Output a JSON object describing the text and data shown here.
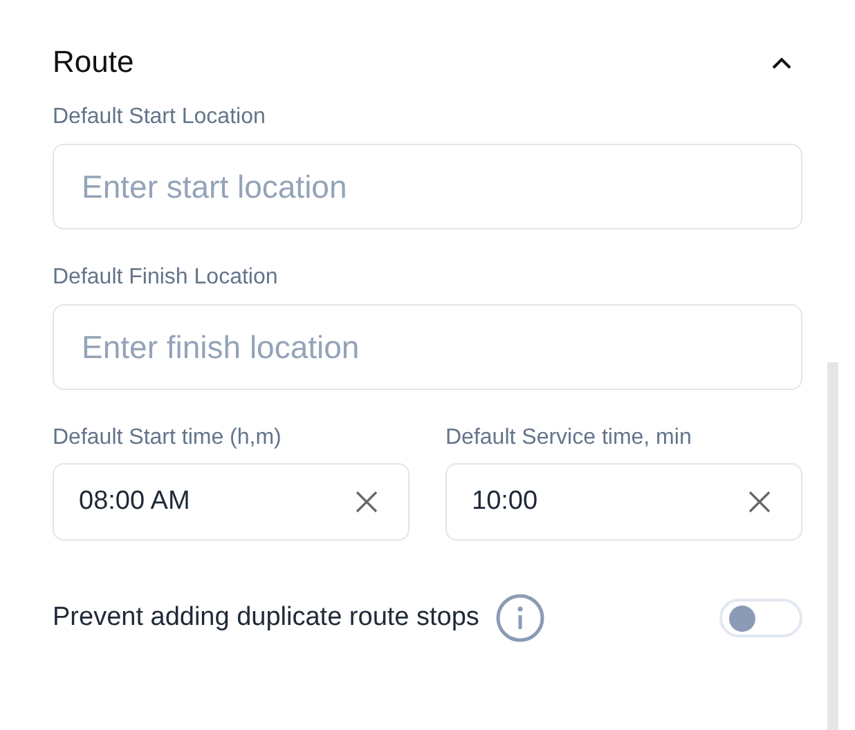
{
  "section": {
    "title": "Route",
    "expanded": true
  },
  "fields": [
    {
      "kind": "wide",
      "label": "Default Start Location",
      "placeholder": "Enter start location"
    },
    {
      "kind": "wide",
      "label": "Default Finish Location",
      "placeholder": "Enter finish location"
    },
    {
      "kind": "half",
      "label": "Default Start time (h,m)",
      "value": "08:00 AM"
    },
    {
      "kind": "half",
      "label": "Default Service time, min",
      "value": "10:00"
    }
  ],
  "toggle": {
    "label": "Prevent adding duplicate route stops",
    "on": false
  }
}
